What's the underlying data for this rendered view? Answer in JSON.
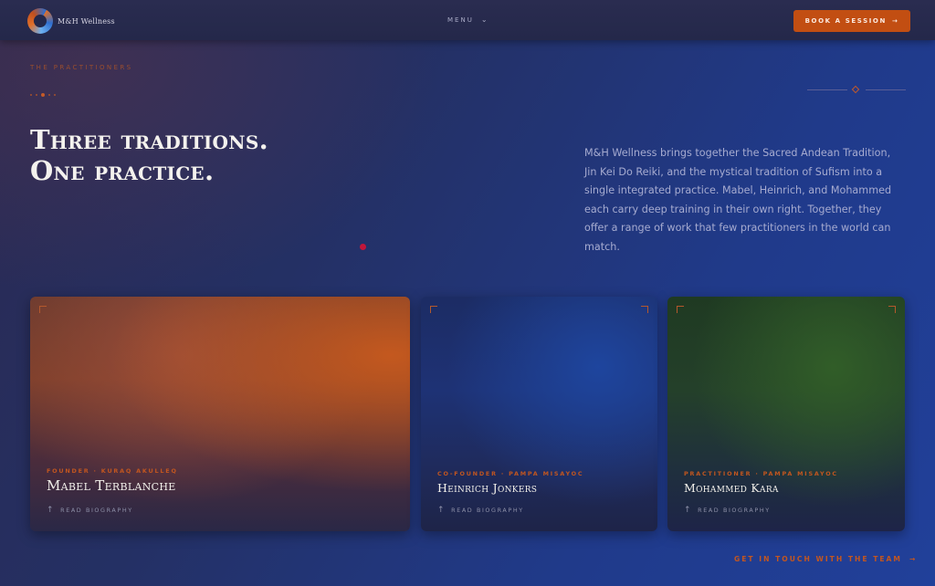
{
  "header": {
    "brand": "M&H Wellness",
    "menu_label": "MENU",
    "book_label": "BOOK A SESSION"
  },
  "section": {
    "eyebrow": "THE PRACTITIONERS",
    "headline_line1": "Three traditions.",
    "headline_line2": "One practice.",
    "intro": "M&H Wellness brings together the Sacred Andean Tradition, Jin Kei Do Reiki, and the mystical tradition of Sufism into a single integrated practice. Mabel, Heinrich, and Mohammed each carry deep training in their own right. Together, they offer a range of work that few practitioners in the world can match."
  },
  "practitioners": [
    {
      "role": "FOUNDER · KURAQ AKULLEQ",
      "name": "Mabel Terblanche",
      "link": "READ BIOGRAPHY"
    },
    {
      "role": "CO-FOUNDER · PAMPA MISAYOC",
      "name": "Heinrich Jonkers",
      "link": "READ BIOGRAPHY"
    },
    {
      "role": "PRACTITIONER · PAMPA MISAYOC",
      "name": "Mohammed Kara",
      "link": "READ BIOGRAPHY"
    }
  ],
  "contact_label": "GET IN TOUCH WITH THE TEAM",
  "colors": {
    "accent": "#c24e12",
    "background": "#233272",
    "text_muted": "#a6abd0"
  },
  "icons": {
    "menu": "chevron-down-icon",
    "book": "arrow-right-icon",
    "card_link": "arrow-up-icon",
    "contact": "arrow-right-icon"
  }
}
